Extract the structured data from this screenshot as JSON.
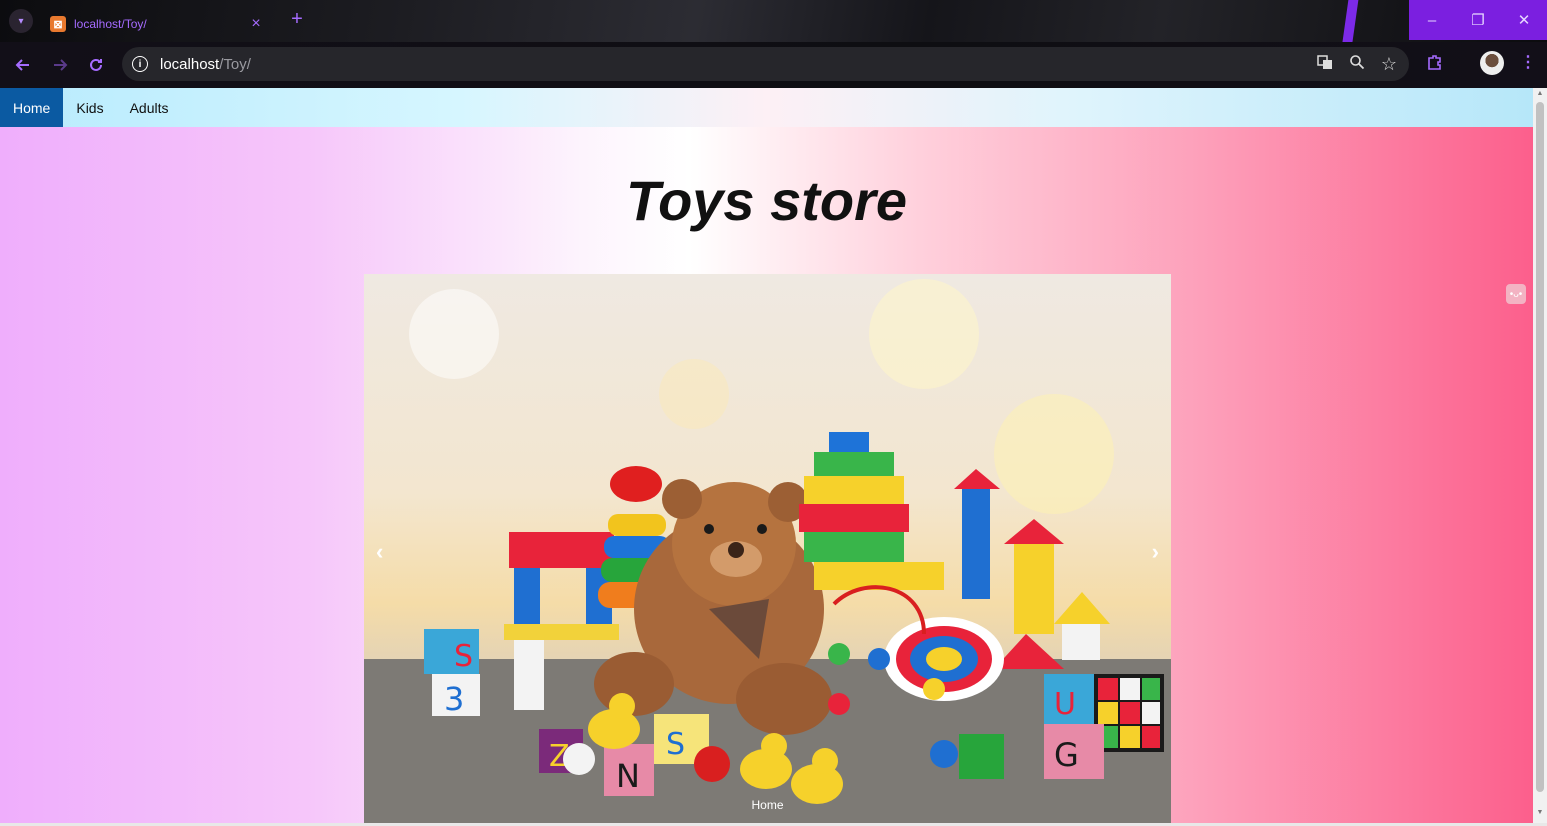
{
  "browser": {
    "tab_title": "localhost/Toy/",
    "tab_close": "×",
    "new_tab": "+",
    "favicon_glyph": "⊠",
    "url_host": "localhost",
    "url_path": "/Toy/",
    "accent_color": "#7b1fe0",
    "window_controls": {
      "minimize": "–",
      "restore": "❐",
      "close": "✕"
    },
    "icons": [
      "back-icon",
      "forward-icon",
      "reload-icon",
      "info-icon",
      "translate-icon",
      "zoom-icon",
      "bookmark-star-icon",
      "extensions-icon",
      "profile-icon",
      "menu-icon"
    ]
  },
  "navbar": {
    "items": [
      {
        "label": "Home",
        "active": true
      },
      {
        "label": "Kids",
        "active": false
      },
      {
        "label": "Adults",
        "active": false
      }
    ],
    "active_color": "#0b5aa2"
  },
  "page": {
    "title": "Toys store"
  },
  "carousel": {
    "prev": "‹",
    "next": "›",
    "caption": "Home",
    "image_description": "Pile of colorful toys with a teddy bear"
  }
}
